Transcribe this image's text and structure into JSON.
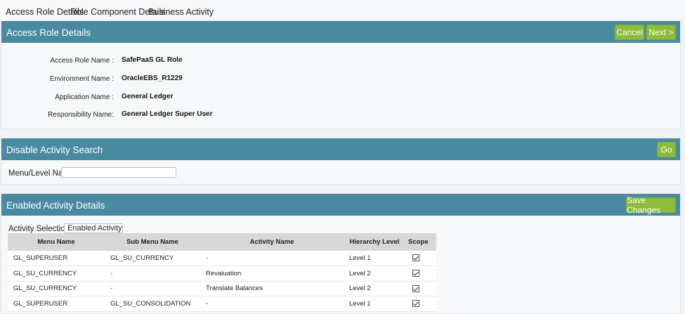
{
  "tabs": [
    {
      "label": "Access Role Details"
    },
    {
      "label": "Role Component Details"
    },
    {
      "label": "Business Activity"
    }
  ],
  "access_role_panel": {
    "title": "Access Role Details",
    "cancel_label": "Cancel",
    "next_label": "Next >",
    "fields": [
      {
        "label": "Access Role Name :",
        "value": "SafePaaS GL Role"
      },
      {
        "label": "Environment Name :",
        "value": "OracleEBS_R1229"
      },
      {
        "label": "Application Name :",
        "value": "General Ledger"
      },
      {
        "label": "Responsibility Name:",
        "value": "General Ledger Super User"
      }
    ]
  },
  "search_panel": {
    "title": "Disable Activity Search",
    "go_label": "Go",
    "menu_level_label": "Menu/Level Name",
    "menu_level_value": ""
  },
  "enabled_panel": {
    "title": "Enabled Activity Details",
    "save_label": "Save Changes",
    "activity_selection_label": "Activity Selection :",
    "activity_selection_value": "Enabled Activity"
  },
  "table": {
    "headers": [
      "Menu Name",
      "Sub Menu Name",
      "Activity Name",
      "Hierarchy Level",
      "Scope"
    ],
    "rows": [
      {
        "menu": "GL_SUPERUSER",
        "sub_menu": "GL_SU_CURRENCY",
        "activity": "-",
        "level": "Level 1",
        "scope_checked": true
      },
      {
        "menu": "GL_SU_CURRENCY",
        "sub_menu": "-",
        "activity": "Revaluation",
        "level": "Level 2",
        "scope_checked": true
      },
      {
        "menu": "GL_SU_CURRENCY",
        "sub_menu": "-",
        "activity": "Translate Balances",
        "level": "Level 2",
        "scope_checked": true
      },
      {
        "menu": "GL_SUPERUSER",
        "sub_menu": "GL_SU_CONSOLIDATION",
        "activity": "-",
        "level": "Level 1",
        "scope_checked": true
      }
    ]
  }
}
